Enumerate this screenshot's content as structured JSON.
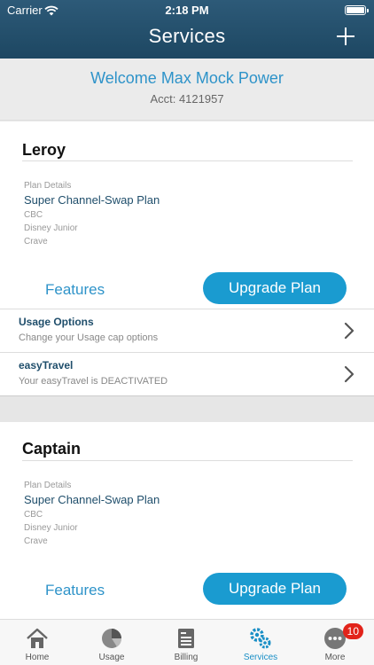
{
  "status_bar": {
    "carrier": "Carrier",
    "time": "2:18 PM"
  },
  "header": {
    "title": "Services"
  },
  "welcome": {
    "greeting": "Welcome Max Mock Power",
    "account": "Acct: 4121957"
  },
  "cards": [
    {
      "name": "Leroy",
      "plan_caption": "Plan Details",
      "plan_name": "Super Channel-Swap Plan",
      "channels": [
        "CBC",
        "Disney Junior",
        "Crave"
      ],
      "features_label": "Features",
      "upgrade_label": "Upgrade Plan",
      "rows": [
        {
          "title": "Usage Options",
          "subtitle": "Change your Usage cap options"
        },
        {
          "title": "easyTravel",
          "subtitle": "Your easyTravel is DEACTIVATED"
        }
      ]
    },
    {
      "name": "Captain",
      "plan_caption": "Plan Details",
      "plan_name": "Super Channel-Swap Plan",
      "channels": [
        "CBC",
        "Disney Junior",
        "Crave"
      ],
      "features_label": "Features",
      "upgrade_label": "Upgrade Plan"
    }
  ],
  "tabs": [
    {
      "label": "Home",
      "icon": "home-icon"
    },
    {
      "label": "Usage",
      "icon": "pie-chart-icon"
    },
    {
      "label": "Billing",
      "icon": "bill-icon"
    },
    {
      "label": "Services",
      "icon": "gears-icon",
      "active": true
    },
    {
      "label": "More",
      "icon": "more-icon",
      "badge": "10"
    }
  ],
  "colors": {
    "header": "#1d4762",
    "accent": "#2e93c9",
    "button": "#1a9bd0",
    "badge": "#e2231a"
  }
}
